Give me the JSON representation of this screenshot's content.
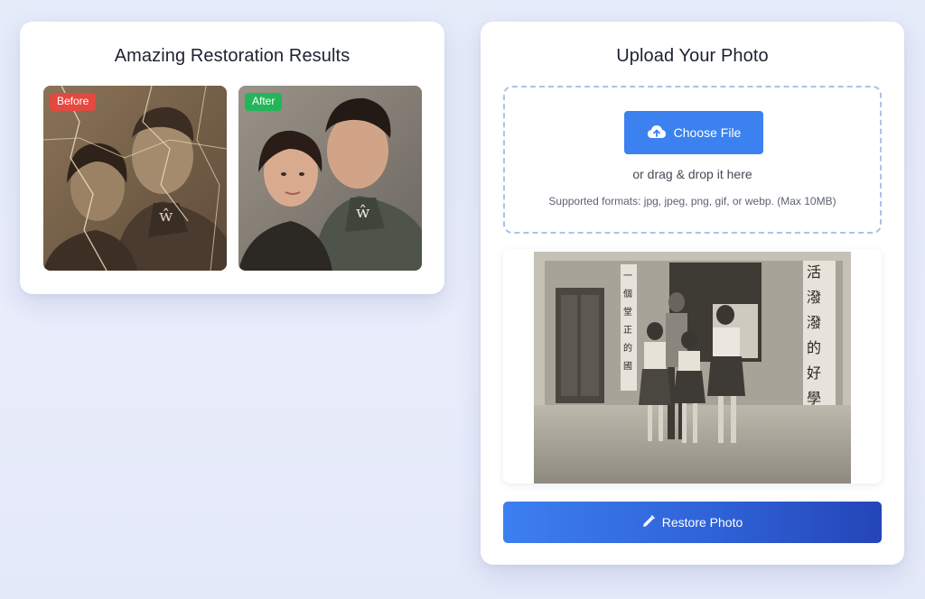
{
  "results": {
    "title": "Amazing Restoration Results",
    "before_label": "Before",
    "after_label": "After"
  },
  "upload": {
    "title": "Upload Your Photo",
    "choose_label": "Choose File",
    "choose_icon": "cloud-upload-icon",
    "drag_text": "or drag & drop it here",
    "formats_text": "Supported formats: jpg, jpeg, png, gif, or webp. (Max 10MB)",
    "restore_label": "Restore Photo",
    "restore_icon": "pencil-icon"
  },
  "colors": {
    "accent": "#3b82f0",
    "restore_gradient_end": "#2445b8",
    "before_badge": "#e5483f",
    "after_badge": "#23b559",
    "dropzone_border": "#a9c3ec"
  }
}
